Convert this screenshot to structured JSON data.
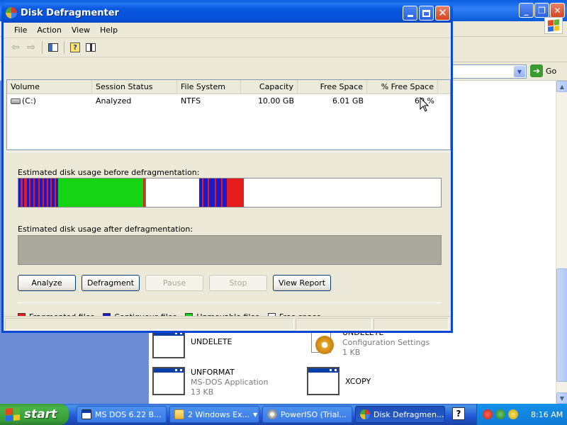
{
  "window": {
    "title": "Disk Defragmenter",
    "menu": [
      "File",
      "Action",
      "View",
      "Help"
    ]
  },
  "toolbar": {
    "icons": [
      "back-arrow-icon",
      "forward-arrow-icon",
      "properties-icon",
      "help-icon",
      "split-view-icon"
    ]
  },
  "volume_list": {
    "columns": [
      "Volume",
      "Session Status",
      "File System",
      "Capacity",
      "Free Space",
      "% Free Space"
    ],
    "rows": [
      {
        "volume": "(C:)",
        "status": "Analyzed",
        "fs": "NTFS",
        "capacity": "10.00 GB",
        "free": "6.01 GB",
        "pct": "60 %"
      }
    ]
  },
  "usage": {
    "before_label": "Estimated disk usage before defragmentation:",
    "after_label": "Estimated disk usage after defragmentation:"
  },
  "buttons": {
    "analyze": "Analyze",
    "defragment": "Defragment",
    "pause": "Pause",
    "stop": "Stop",
    "view_report": "View Report"
  },
  "legend": {
    "fragmented": "Fragmented files",
    "contiguous": "Contiguous files",
    "unmovable": "Unmovable files",
    "free": "Free space"
  },
  "colors": {
    "fragmented": "#e51c1c",
    "contiguous": "#1a1ac8",
    "unmovable": "#14d414",
    "free": "#ffffff"
  },
  "explorer": {
    "go_label": "Go",
    "items": [
      {
        "name": "UNDELETE",
        "sub1": "",
        "sub2": ""
      },
      {
        "name": "UNDELETE",
        "sub1": "Configuration Settings",
        "sub2": "1 KB"
      },
      {
        "name": "UNFORMAT",
        "sub1": "MS-DOS Application",
        "sub2": "13 KB"
      },
      {
        "name": "XCOPY",
        "sub1": "",
        "sub2": ""
      }
    ]
  },
  "taskbar": {
    "start_label": "start",
    "tasks": [
      {
        "label": "MS DOS 6.22 B..."
      },
      {
        "label": "2 Windows Ex..."
      },
      {
        "label": "PowerISO (Trial..."
      },
      {
        "label": "Disk Defragmen..."
      }
    ],
    "help_glyph": "?",
    "clock": "8:16 AM"
  }
}
